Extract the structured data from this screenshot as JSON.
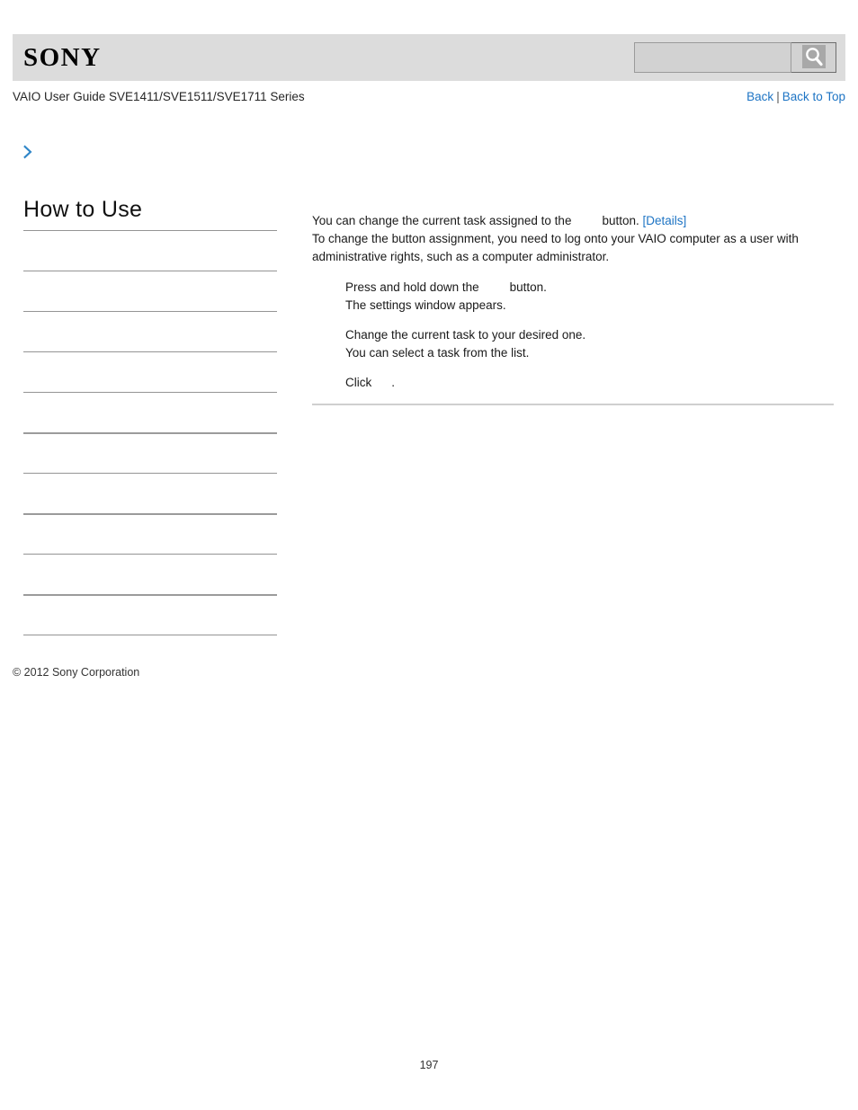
{
  "header": {
    "logo_text": "SONY",
    "search": {
      "value": "",
      "placeholder": "",
      "button_icon": "search-icon"
    }
  },
  "subheader": {
    "guide_title": "VAIO User Guide SVE1411/SVE1511/SVE1711 Series",
    "back_label": "Back",
    "separator": "|",
    "back_to_top_label": "Back to Top"
  },
  "breadcrumb": {
    "icon": "chevron-right-icon",
    "text": ""
  },
  "sidebar": {
    "heading": "How to Use",
    "items": [
      {
        "label": "",
        "thick": false
      },
      {
        "label": "",
        "thick": false
      },
      {
        "label": "",
        "thick": false
      },
      {
        "label": "",
        "thick": false
      },
      {
        "label": "",
        "thick": false
      },
      {
        "label": "",
        "thick": true
      },
      {
        "label": "",
        "thick": false
      },
      {
        "label": "",
        "thick": true
      },
      {
        "label": "",
        "thick": false
      },
      {
        "label": "",
        "thick": true
      },
      {
        "label": "",
        "thick": false
      }
    ]
  },
  "content": {
    "intro_line1_a": "You can change the current task assigned to the",
    "intro_line1_b": "button.",
    "details_link": "[Details]",
    "intro_line2": "To change the button assignment, you need to log onto your VAIO computer as a user with administrative rights, such as a computer administrator.",
    "steps": [
      {
        "main_a": "Press and hold down the",
        "main_b": "button.",
        "sub": "The settings window appears."
      },
      {
        "main_a": "Change the current task to your desired one.",
        "main_b": "",
        "sub": "You can select a task from the list."
      },
      {
        "main_a": "Click",
        "main_b": ".",
        "sub": ""
      }
    ]
  },
  "footer": {
    "copyright": "© 2012 Sony Corporation",
    "page_number": "197"
  },
  "colors": {
    "link": "#1d74c4",
    "header_bg": "#dcdcdc",
    "rule": "#949494"
  }
}
